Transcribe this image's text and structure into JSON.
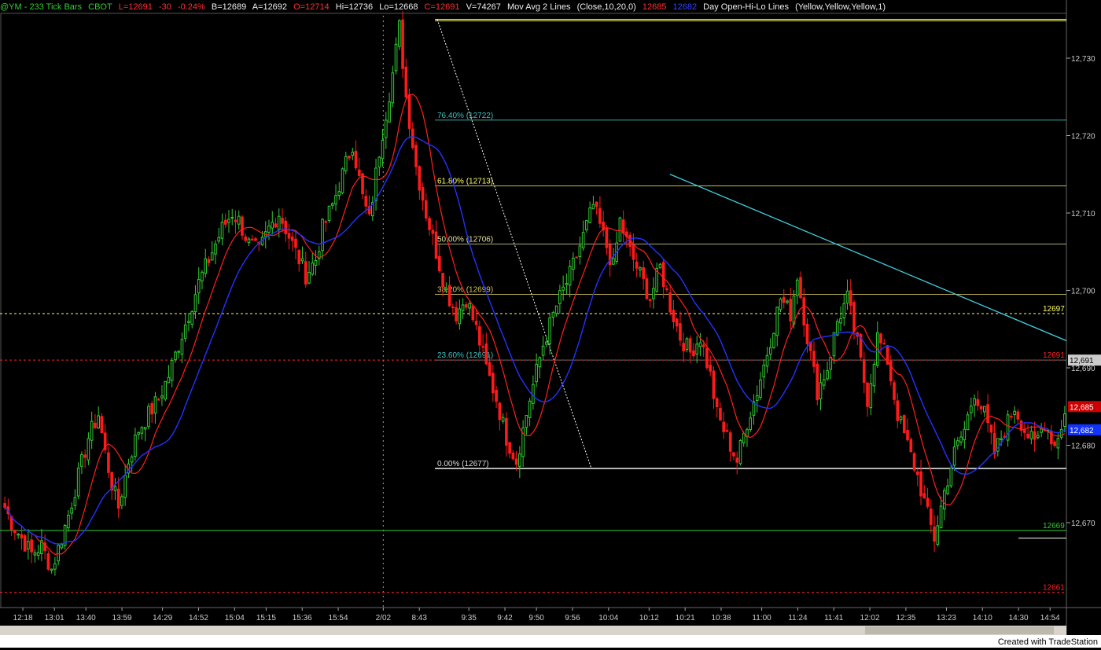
{
  "header": {
    "symbol": "@YM - 233 Tick Bars",
    "exchange": "CBOT",
    "last": "L=12691",
    "change": "-30",
    "change_pct": "-0.24%",
    "bid": "B=12689",
    "ask": "A=12692",
    "open": "O=12714",
    "high": "Hi=12736",
    "low": "Lo=12668",
    "close": "C=12691",
    "volume": "V=74267",
    "ma_label": "Mov Avg 2 Lines",
    "ma_params": "(Close,10,20,0)",
    "ma_fast": "12685",
    "ma_slow": "12682",
    "study_label": "Day Open-Hi-Lo Lines",
    "study_params": "(Yellow,Yellow,Yellow,1)"
  },
  "colors": {
    "up": "#33cc33",
    "down": "#ff1a1a",
    "ma_fast": "#ff2020",
    "ma_slow": "#2233ff",
    "fib": "#e8e8a0",
    "trend": "#40d0e0",
    "grid": "#3a3a3a"
  },
  "chart_data": {
    "type": "candlestick",
    "ylim": [
      12661,
      12735
    ],
    "y_ticks": [
      "12,730",
      "12,720",
      "12,710",
      "12,700",
      "12,690",
      "12,680",
      "12,670"
    ],
    "y_tick_values": [
      12730,
      12720,
      12710,
      12700,
      12690,
      12680,
      12670
    ],
    "x_tick_labels": [
      "12:18",
      "13:01",
      "13:40",
      "13:59",
      "14:29",
      "14:52",
      "15:04",
      "15:15",
      "15:36",
      "15:54",
      "2/02",
      "8:43",
      "9:35",
      "9:42",
      "9:50",
      "9:56",
      "10:04",
      "10:12",
      "10:21",
      "10:38",
      "11:00",
      "11:24",
      "11:41",
      "12:02",
      "12:35",
      "13:23",
      "14:10",
      "14:30",
      "14:54"
    ],
    "x_tick_bar_index": [
      4,
      11,
      18,
      26,
      35,
      43,
      51,
      58,
      66,
      74,
      84,
      92,
      103,
      111,
      118,
      126,
      134,
      143,
      151,
      159,
      168,
      176,
      184,
      192,
      200,
      209,
      217,
      225,
      232
    ],
    "session_break_index": 84,
    "fib_levels": [
      {
        "label": "76.40% (12722)",
        "value": 12722
      },
      {
        "label": "61.80% (12713)",
        "value": 12713.5
      },
      {
        "label": "50.00% (12706)",
        "value": 12706
      },
      {
        "label": "38.20% (12699)",
        "value": 12699.5
      },
      {
        "label": "23.60% (12691)",
        "value": 12691
      },
      {
        "label": "0.00% (12677)",
        "value": 12677
      }
    ],
    "price_lines": [
      {
        "label": "12697",
        "value": 12697,
        "color": "#ffff66",
        "dash": true
      },
      {
        "label": "12691",
        "value": 12691,
        "color": "#ff2020",
        "dash": true
      },
      {
        "label": "12669",
        "value": 12669,
        "color": "#33cc33",
        "dash": false
      },
      {
        "label": "12661",
        "value": 12661,
        "color": "#ff2020",
        "dash": true
      }
    ],
    "day_high_line": 12735,
    "day_open_line": 12714,
    "axis_markers": [
      {
        "label": "12,691",
        "value": 12691,
        "bg": "#cccccc",
        "fg": "#000000"
      },
      {
        "label": "12,685",
        "value": 12685,
        "bg": "#cc0000",
        "fg": "#ffffff"
      },
      {
        "label": "12,682",
        "value": 12682,
        "bg": "#1133ff",
        "fg": "#ffffff"
      }
    ],
    "anchors": [
      12672,
      12670,
      12668,
      12666,
      12667,
      12664,
      12668,
      12671,
      12676,
      12681,
      12684,
      12679,
      12675,
      12672,
      12678,
      12682,
      12684,
      12686,
      12689,
      12693,
      12697,
      12701,
      12704,
      12706,
      12708,
      12710,
      12709,
      12706,
      12705,
      12708,
      12710,
      12707,
      12704,
      12702,
      12704,
      12708,
      12711,
      12715,
      12719,
      12712,
      12709,
      12718,
      12728,
      12734,
      12725,
      12716,
      12710,
      12705,
      12700,
      12697,
      12699,
      12695,
      12690,
      12686,
      12681,
      12678,
      12686,
      12693,
      12698,
      12702,
      12707,
      12711,
      12707,
      12703,
      12709,
      12705,
      12702,
      12699,
      12703,
      12698,
      12694,
      12692,
      12694,
      12689,
      12684,
      12681,
      12678,
      12683,
      12687,
      12692,
      12699,
      12697,
      12702,
      12694,
      12687,
      12690,
      12696,
      12699,
      12693,
      12686,
      12694,
      12691,
      12684,
      12680,
      12676,
      12671,
      12668,
      12674,
      12679,
      12682,
      12687,
      12684,
      12679,
      12682,
      12685,
      12682,
      12680,
      12683,
      12680,
      12684
    ],
    "anchor_points": [
      0,
      2,
      5,
      8,
      11,
      14,
      17,
      19,
      22,
      25,
      28,
      30,
      32,
      34,
      37,
      40,
      43,
      46,
      49,
      52,
      55,
      58,
      61,
      63,
      65,
      68,
      70,
      73,
      76,
      79,
      82,
      85,
      88,
      90,
      93,
      95,
      98,
      101,
      104,
      107,
      109,
      112,
      116,
      118,
      120,
      123,
      126,
      129,
      132,
      135,
      138,
      141,
      144,
      147,
      150,
      153,
      157,
      161,
      165,
      169,
      173,
      176,
      179,
      182,
      184,
      187,
      190,
      193,
      196,
      199,
      202,
      205,
      208,
      211,
      213,
      216,
      219,
      222,
      225,
      228,
      232,
      235,
      237,
      240,
      243,
      246,
      249,
      252,
      255,
      258,
      261,
      264,
      267,
      270,
      273,
      276,
      278,
      281,
      284,
      287,
      290,
      293,
      296,
      299,
      302,
      305,
      308,
      311,
      314,
      317
    ]
  }
}
